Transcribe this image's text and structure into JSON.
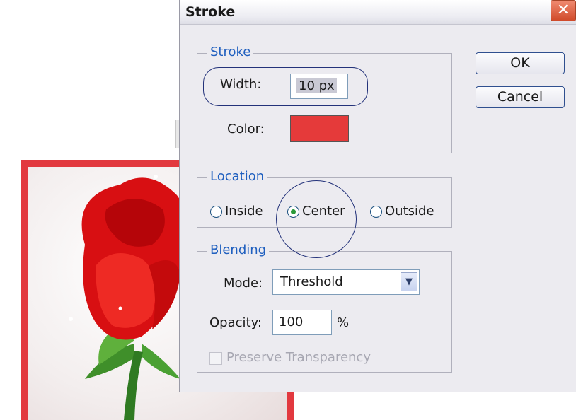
{
  "dialog": {
    "title": "Stroke",
    "close_glyph": "✕",
    "ok_label": "OK",
    "cancel_label": "Cancel"
  },
  "stroke_group": {
    "legend": "Stroke",
    "width_label": "Width:",
    "width_value": "10 px",
    "color_label": "Color:",
    "color_value": "#e53a3a"
  },
  "location_group": {
    "legend": "Location",
    "options": [
      "Inside",
      "Center",
      "Outside"
    ],
    "selected": "Center"
  },
  "blending_group": {
    "legend": "Blending",
    "mode_label": "Mode:",
    "mode_value": "Threshold",
    "opacity_label": "Opacity:",
    "opacity_value": "100",
    "opacity_unit": "%",
    "preserve_label": "Preserve Transparency",
    "preserve_checked": false,
    "preserve_enabled": false
  },
  "colors": {
    "accent": "#1f5fbf",
    "stroke_border": "#e2393f",
    "annotation": "#23327a"
  }
}
